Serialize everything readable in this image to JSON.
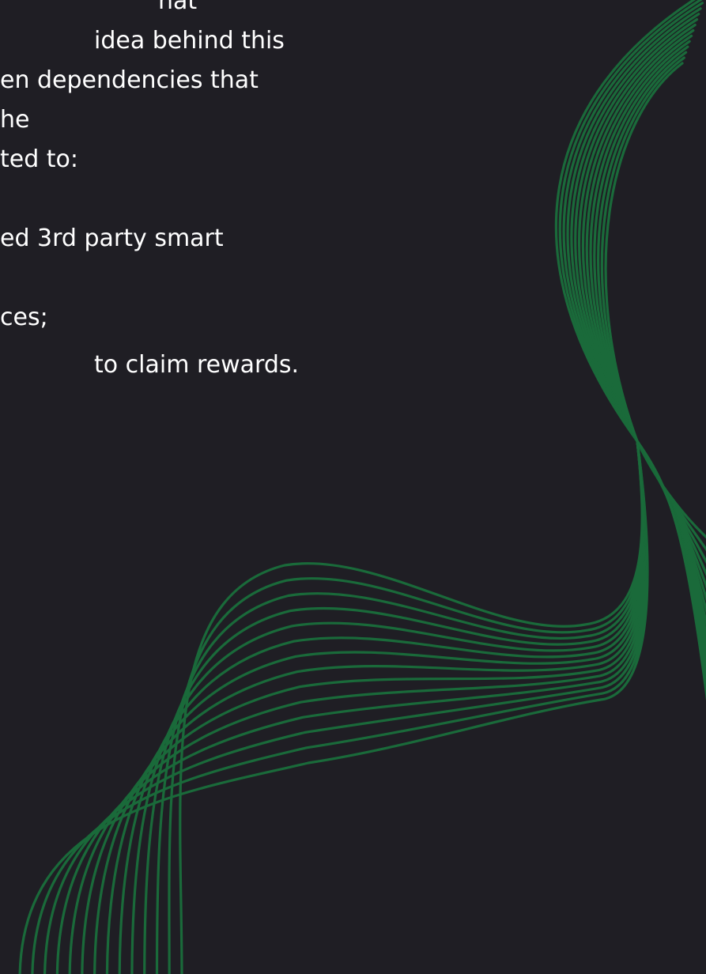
{
  "document": {
    "lines": [
      "hat",
      "idea behind this",
      "en dependencies that",
      "he",
      "ted to:",
      "ed 3rd party smart",
      "ces;",
      "to claim rewards."
    ]
  },
  "decoration": {
    "wave_color": "#1a6a3a",
    "background_color": "#1f1e24"
  }
}
